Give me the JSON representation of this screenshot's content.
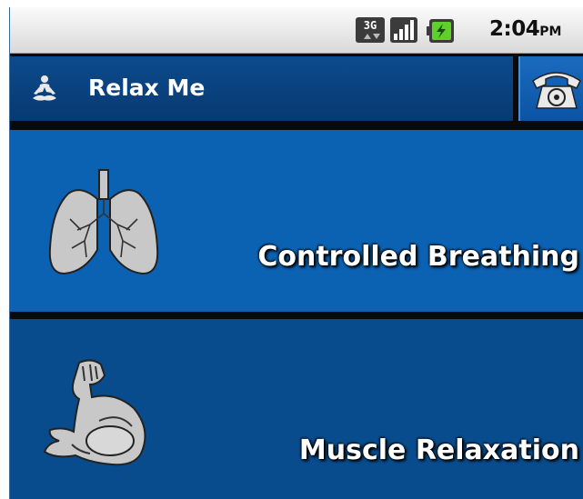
{
  "status_bar": {
    "network_type": "3G",
    "time": "2:04",
    "ampm": "PM",
    "icons": [
      "network-3g-icon",
      "signal-strength-icon",
      "battery-charging-icon"
    ]
  },
  "app_bar": {
    "title": "Relax Me",
    "app_icon": "meditation-figure-icon",
    "action_icon": "telephone-icon"
  },
  "menu": {
    "items": [
      {
        "label": "Controlled Breathing",
        "icon": "lungs-icon"
      },
      {
        "label": "Muscle Relaxation",
        "icon": "flexed-arm-icon"
      }
    ]
  },
  "colors": {
    "title_bar": "#0a4a8c",
    "row_1": "#0b62b2",
    "row_2": "#094c8d",
    "separator": "#0a0a0a"
  }
}
